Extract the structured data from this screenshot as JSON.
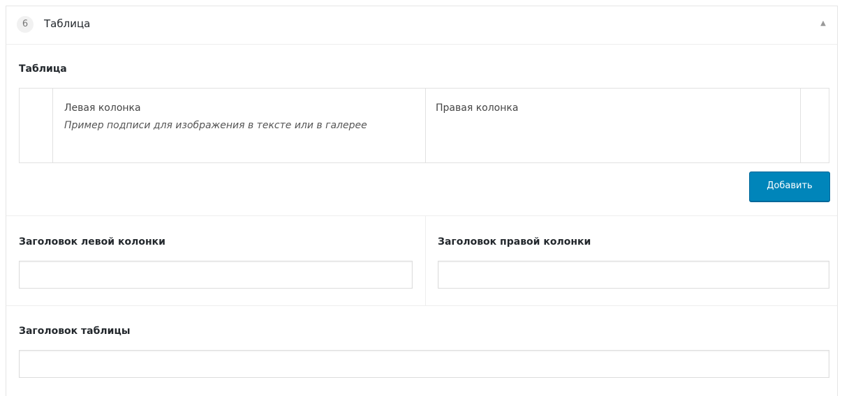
{
  "layout": {
    "row_number": "6",
    "title": "Таблица",
    "collapse_icon": "triangle-up-icon"
  },
  "table_field": {
    "label": "Таблица",
    "rows": [
      {
        "left_main": "Левая колонка",
        "left_caption": "Пример подписи для изображения в тексте или в галерее",
        "right_main": "Правая колонка"
      }
    ],
    "add_label": "Добавить"
  },
  "left_heading": {
    "label": "Заголовок левой колонки",
    "value": "",
    "placeholder": ""
  },
  "right_heading": {
    "label": "Заголовок правой колонки",
    "value": "",
    "placeholder": ""
  },
  "table_heading": {
    "label": "Заголовок таблицы",
    "value": "",
    "placeholder": ""
  },
  "colors": {
    "button": "#0085ba",
    "border": "#e1e1e1"
  }
}
